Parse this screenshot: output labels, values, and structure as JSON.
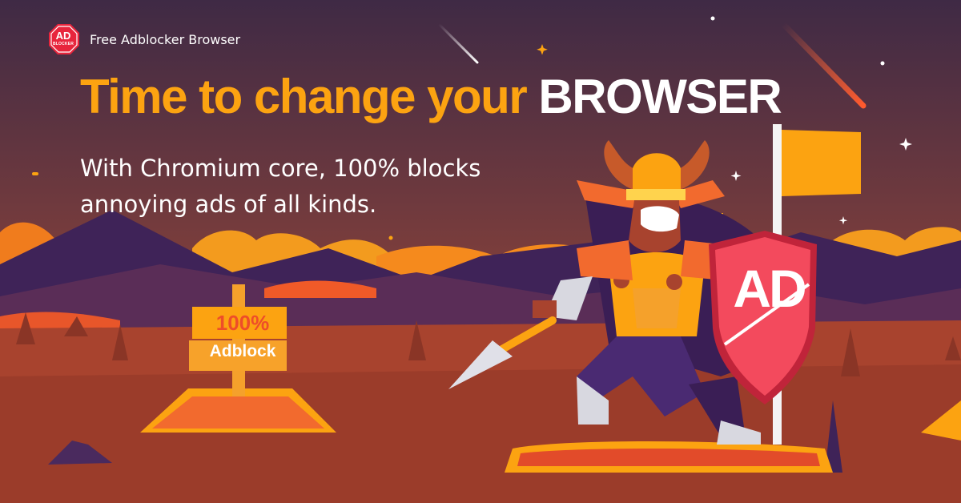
{
  "brand": {
    "logo_text": "AD",
    "logo_subtext": "BLOCKER",
    "name": "Free Adblocker Browser"
  },
  "headline": {
    "part1": "Time to change your",
    "part2": "BROWSER"
  },
  "subheadline": {
    "line1": "With Chromium core, 100% blocks",
    "line2": "annoying ads of all kinds."
  },
  "signpost": {
    "top": "100%",
    "bottom": "Adblock"
  },
  "shield": {
    "text": "AD"
  },
  "colors": {
    "sky_top": "#3f2a45",
    "sky_bottom": "#b45431",
    "accent_orange": "#fca311",
    "brand_red": "#e8253c",
    "shield_red": "#f34a5d",
    "mountain_purple": "#3f2358",
    "ground": "#a8432e"
  },
  "icons": [
    "adblocker-logo-icon",
    "shield-icon",
    "flag-icon",
    "signpost-icon",
    "comet-icon",
    "star-icon"
  ]
}
